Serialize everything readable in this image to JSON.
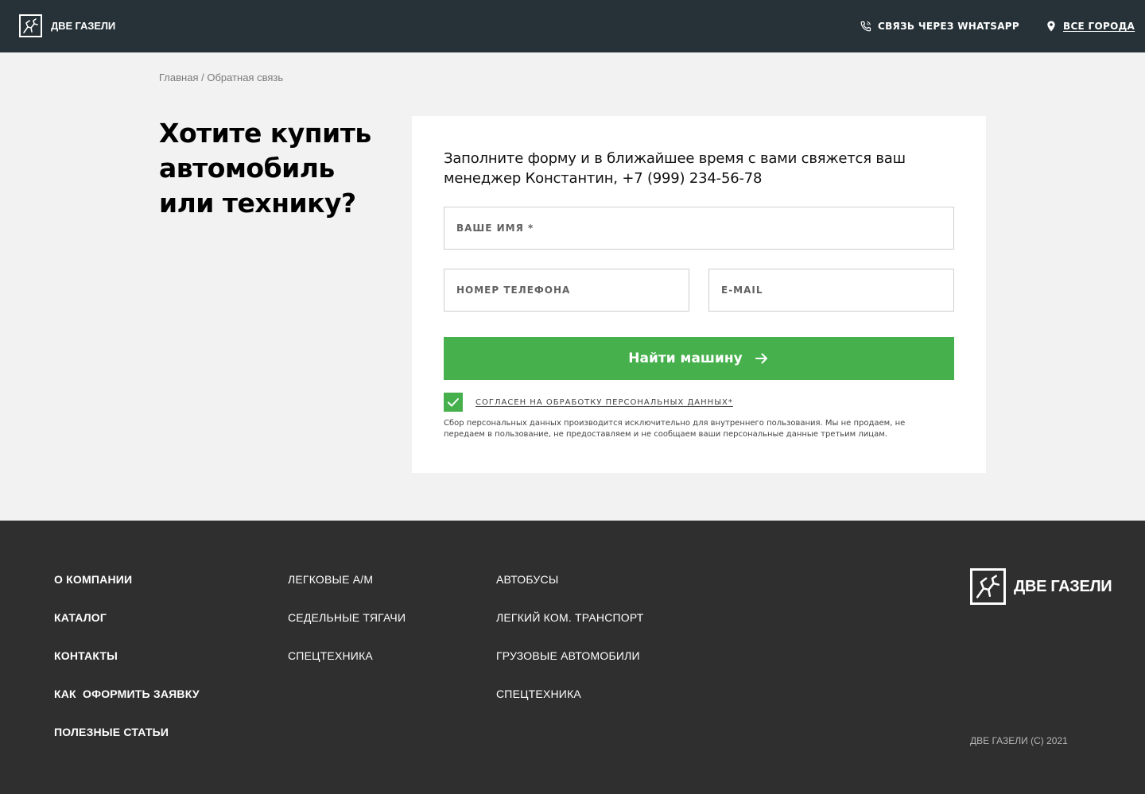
{
  "header": {
    "logo_text": "ДВЕ ГАЗЕЛИ",
    "whatsapp_label": "СВЯЗЬ ЧЕРЕЗ WHATSAPP",
    "city_label": "ВСЕ ГОРОДА"
  },
  "breadcrumb": {
    "home": "Главная",
    "separator": " / ",
    "current": "Обратная связь"
  },
  "page": {
    "title": "Хотите купить автомобиль или технику?"
  },
  "form": {
    "intro": "Заполните форму и в ближайшее время с вами свяжется ваш менеджер Константин, +7 (999) 234-56-78",
    "name_placeholder": "ВАШЕ ИМЯ *",
    "phone_placeholder": "НОМЕР ТЕЛЕФОНА",
    "email_placeholder": "E-MAIL",
    "submit_label": "Найти машину",
    "consent_checked": true,
    "consent_label": "СОГЛАСЕН НА ОБРАБОТКУ ПЕРСОНАЛЬНЫХ ДАННЫХ*",
    "privacy_note": "Сбор персональных данных производится исключительно для внутреннего пользования. Мы не продаем, не передаем в пользование, не предоставляем и не сообщаем ваши персональные данные третьим лицам."
  },
  "footer": {
    "col1": [
      "О КОМПАНИИ",
      "КАТАЛОГ",
      "КОНТАКТЫ",
      "КАК  ОФОРМИТЬ ЗАЯВКУ",
      "ПОЛЕЗНЫЕ СТАТЬИ"
    ],
    "col2": [
      "ЛЕГКОВЫЕ А/М",
      "СЕДЕЛЬНЫЕ ТЯГАЧИ",
      "СПЕЦТЕХНИКА"
    ],
    "col3": [
      "АВТОБУСЫ",
      "ЛЕГКИЙ КОМ. ТРАНСПОРТ",
      "ГРУЗОВЫЕ АВТОМОБИЛИ",
      "СПЕЦТЕХНИКА"
    ],
    "logo_text": "ДВЕ ГАЗЕЛИ",
    "copyright": "ДВЕ ГАЗЕЛИ (С) 2021"
  },
  "icons": {
    "logo": "gazelle-logo-icon",
    "whatsapp": "phone-call-icon",
    "city": "location-pin-icon",
    "submit": "arrow-right-icon",
    "checkbox": "checkmark-icon"
  },
  "colors": {
    "header_bg": "#263238",
    "page_bg": "#f2f2f2",
    "accent_green": "#46b04c",
    "footer_bg": "#2f2f2f"
  }
}
